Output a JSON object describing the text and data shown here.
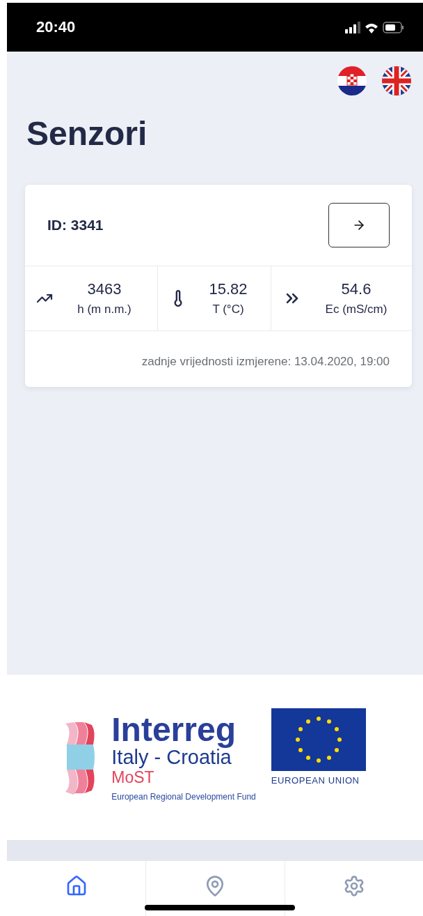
{
  "status_bar": {
    "time": "20:40"
  },
  "languages": [
    {
      "kind": "hr"
    },
    {
      "kind": "en"
    }
  ],
  "title": "Senzori",
  "sensor": {
    "id": "ID: 3341",
    "readings": [
      {
        "kind": "height",
        "value": "3463",
        "unit": "h (m n.m.)"
      },
      {
        "kind": "temperature",
        "value": "15.82",
        "unit": "T (°C)"
      },
      {
        "kind": "conductivity",
        "value": "54.6",
        "unit": "Ec (mS/cm)"
      }
    ],
    "last_measured": "zadnje vrijednosti izmjerene: 13.04.2020, 19:00"
  },
  "footer": {
    "program": "Interreg",
    "region": "Italy - Croatia",
    "project": "MoST",
    "fund": "European Regional Development Fund",
    "eu": "EUROPEAN UNION"
  },
  "tab_bar": [
    {
      "kind": "home",
      "selected": true
    },
    {
      "kind": "map",
      "selected": false
    },
    {
      "kind": "settings",
      "selected": false
    }
  ]
}
